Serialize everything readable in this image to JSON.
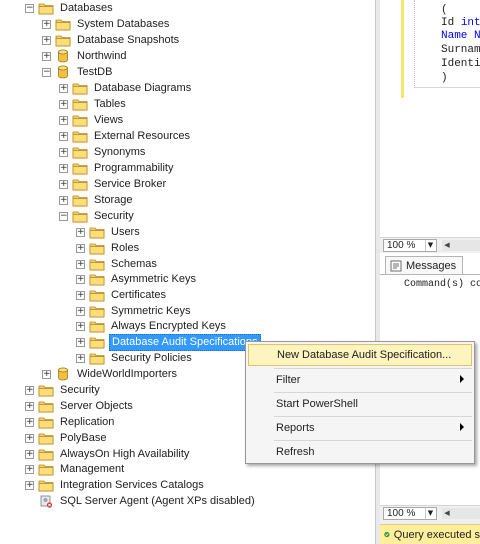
{
  "tree": [
    {
      "label": "Databases",
      "expander": "minus",
      "icon": "folder",
      "selected": false
    },
    {
      "label": "System Databases",
      "expander": "plus",
      "icon": "folder",
      "selected": false
    },
    {
      "label": "Database Snapshots",
      "expander": "plus",
      "icon": "folder",
      "selected": false
    },
    {
      "label": "Northwind",
      "expander": "plus",
      "icon": "database",
      "selected": false
    },
    {
      "label": "TestDB",
      "expander": "minus",
      "icon": "database",
      "selected": false
    },
    {
      "label": "Database Diagrams",
      "expander": "plus",
      "icon": "folder",
      "selected": false
    },
    {
      "label": "Tables",
      "expander": "plus",
      "icon": "folder",
      "selected": false
    },
    {
      "label": "Views",
      "expander": "plus",
      "icon": "folder",
      "selected": false
    },
    {
      "label": "External Resources",
      "expander": "plus",
      "icon": "folder",
      "selected": false
    },
    {
      "label": "Synonyms",
      "expander": "plus",
      "icon": "folder",
      "selected": false
    },
    {
      "label": "Programmability",
      "expander": "plus",
      "icon": "folder",
      "selected": false
    },
    {
      "label": "Service Broker",
      "expander": "plus",
      "icon": "folder",
      "selected": false
    },
    {
      "label": "Storage",
      "expander": "plus",
      "icon": "folder",
      "selected": false
    },
    {
      "label": "Security",
      "expander": "minus",
      "icon": "folder",
      "selected": false
    },
    {
      "label": "Users",
      "expander": "plus",
      "icon": "folder",
      "selected": false
    },
    {
      "label": "Roles",
      "expander": "plus",
      "icon": "folder",
      "selected": false
    },
    {
      "label": "Schemas",
      "expander": "plus",
      "icon": "folder",
      "selected": false
    },
    {
      "label": "Asymmetric Keys",
      "expander": "plus",
      "icon": "folder",
      "selected": false
    },
    {
      "label": "Certificates",
      "expander": "plus",
      "icon": "folder",
      "selected": false
    },
    {
      "label": "Symmetric Keys",
      "expander": "plus",
      "icon": "folder",
      "selected": false
    },
    {
      "label": "Always Encrypted Keys",
      "expander": "plus",
      "icon": "folder",
      "selected": false
    },
    {
      "label": "Database Audit Specifications",
      "expander": "plus",
      "icon": "folder",
      "selected": true
    },
    {
      "label": "Security Policies",
      "expander": "plus",
      "icon": "folder",
      "selected": false
    },
    {
      "label": "WideWorldImporters",
      "expander": "plus",
      "icon": "database",
      "selected": false
    },
    {
      "label": "Security",
      "expander": "plus",
      "icon": "folder",
      "selected": false
    },
    {
      "label": "Server Objects",
      "expander": "plus",
      "icon": "folder",
      "selected": false
    },
    {
      "label": "Replication",
      "expander": "plus",
      "icon": "folder",
      "selected": false
    },
    {
      "label": "PolyBase",
      "expander": "plus",
      "icon": "folder",
      "selected": false
    },
    {
      "label": "AlwaysOn High Availability",
      "expander": "plus",
      "icon": "folder",
      "selected": false
    },
    {
      "label": "Management",
      "expander": "plus",
      "icon": "folder",
      "selected": false
    },
    {
      "label": "Integration Services Catalogs",
      "expander": "plus",
      "icon": "folder",
      "selected": false
    },
    {
      "label": "SQL Server Agent (Agent XPs disabled)",
      "expander": "none",
      "icon": "agent",
      "selected": false
    }
  ],
  "context_menu": {
    "items": [
      {
        "label": "New Database Audit Specification...",
        "submenu": false,
        "highlighted": true
      },
      {
        "label": "Filter",
        "submenu": true,
        "highlighted": false
      },
      {
        "label": "Start PowerShell",
        "submenu": false,
        "highlighted": false
      },
      {
        "label": "Reports",
        "submenu": true,
        "highlighted": false
      },
      {
        "label": "Refresh",
        "submenu": false,
        "highlighted": false
      }
    ]
  },
  "editor": {
    "code_lines": [
      {
        "text": "(",
        "keyword": ""
      },
      {
        "text": "Id ",
        "keyword": "int"
      },
      {
        "text": "Name N",
        "keyword": ""
      },
      {
        "text": "Surname",
        "keyword": ""
      },
      {
        "text": "Identit",
        "keyword": ""
      },
      {
        "text": ")",
        "keyword": ""
      }
    ],
    "zoom_top": "100 %",
    "zoom_bottom": "100 %",
    "messages_tab": "Messages",
    "message_text": "Command(s) co",
    "status_text": "Query executed s"
  },
  "colors": {
    "selection": "#3399ff",
    "menu_highlight": "#fdf4bf",
    "status_bar": "#ffef9c",
    "keyword": "#0000ff"
  }
}
